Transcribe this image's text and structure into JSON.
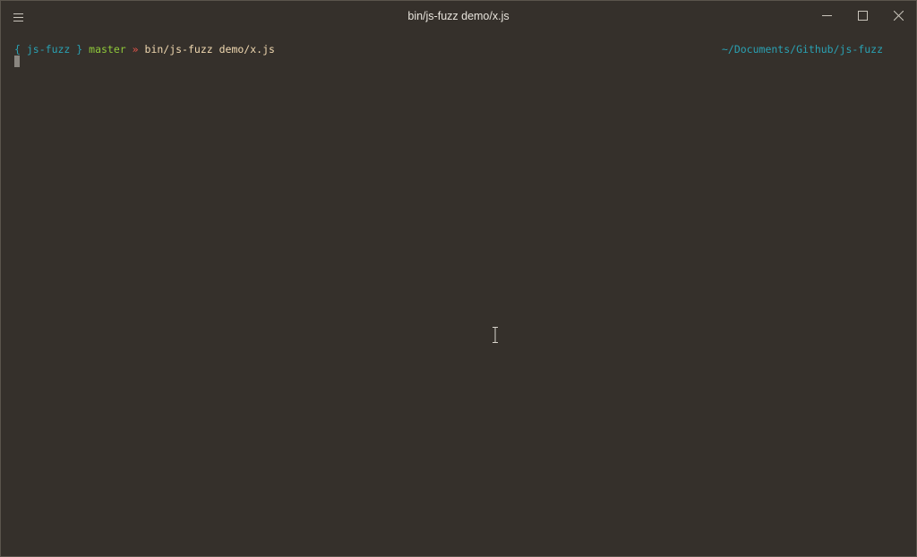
{
  "window": {
    "title": "bin/js-fuzz demo/x.js",
    "controls": {
      "menu_icon": "hamburger-menu-icon",
      "minimize_icon": "minimize-icon",
      "maximize_icon": "maximize-icon",
      "close_icon": "close-icon"
    }
  },
  "terminal": {
    "prompt": {
      "open_brace": "{",
      "repo": "js-fuzz",
      "close_brace": "}",
      "branch": "master",
      "separator": "»",
      "command": "bin/js-fuzz demo/x.js"
    },
    "cwd": "~/Documents/Github/js-fuzz",
    "colors": {
      "background": "#35302b",
      "repo": "#2aa1b3",
      "branch": "#8fc93a",
      "separator": "#e0534a",
      "command": "#f0d8b0",
      "cwd": "#2aa1b3"
    }
  }
}
